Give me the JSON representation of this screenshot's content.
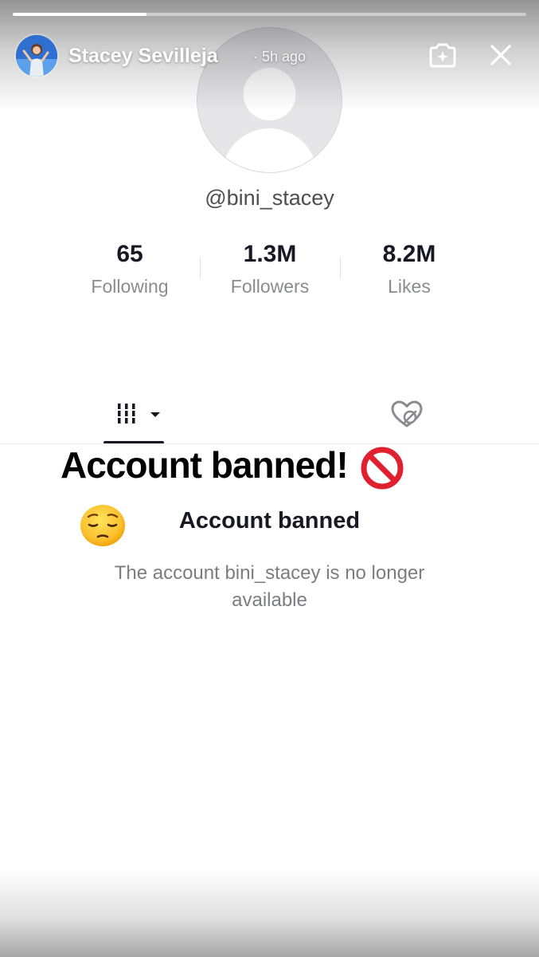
{
  "story": {
    "progress": 0.26,
    "username": "Stacey Sevilleja",
    "time": "· 5h ago",
    "icons": {
      "camera": "camera-sparkle-icon",
      "close": "close-icon"
    }
  },
  "profile": {
    "handle": "@bini_stacey",
    "stats": [
      {
        "value": "65",
        "label": "Following"
      },
      {
        "value": "1.3M",
        "label": "Followers"
      },
      {
        "value": "8.2M",
        "label": "Likes"
      }
    ],
    "tabs": {
      "grid_icon": "grid-icon",
      "liked_icon": "liked-hidden-icon"
    }
  },
  "banner": {
    "title": "Account banned!",
    "title_icon": "prohibited-icon",
    "emoji": "pensive-face-icon",
    "subtitle": "Account banned",
    "description": "The account bini_stacey is no longer available"
  },
  "colors": {
    "text_primary": "#161823",
    "text_secondary": "#8a8b91",
    "prohibited_red": "#e0202e"
  }
}
